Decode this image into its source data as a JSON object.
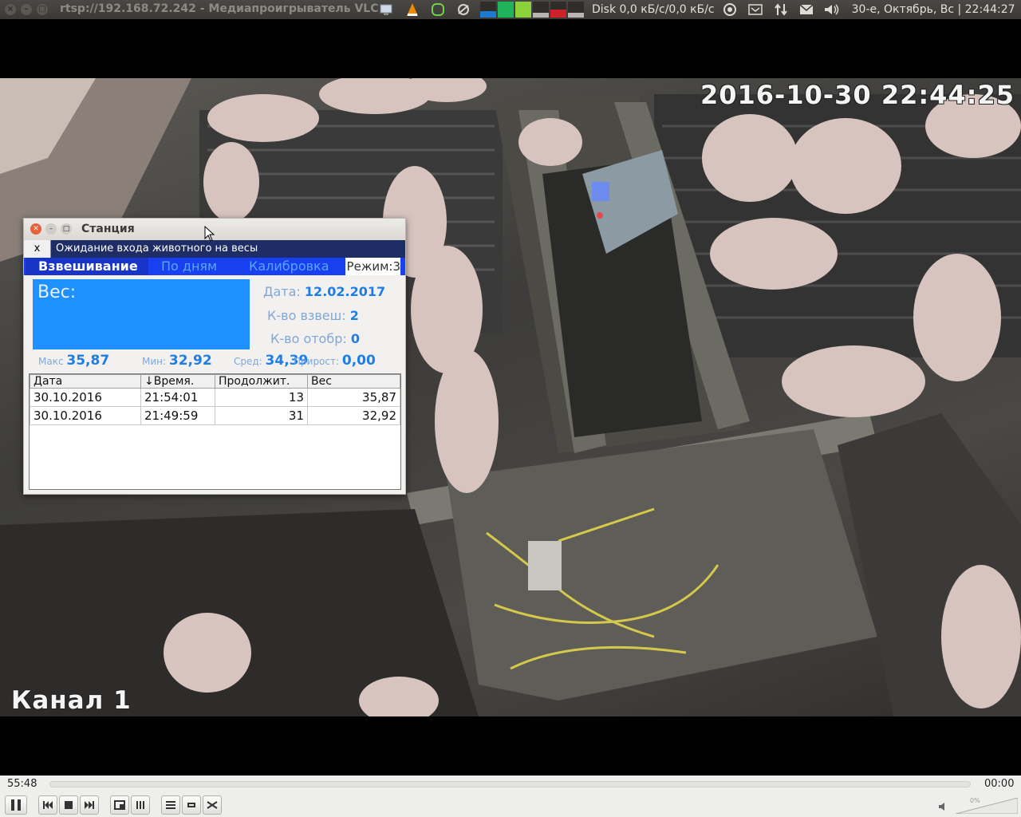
{
  "panel": {
    "window_title": "rtsp://192.168.72.242 - Медиапроигрыватель VLC",
    "window_buttons": [
      "×",
      "–",
      "□"
    ],
    "disk": "Disk 0,0 кБ/с/0,0 кБ/с",
    "clock": "30-е, Октябрь, Вс | 22:44:27",
    "tray_icons": [
      "network-icon",
      "vlc-icon",
      "evernote-icon",
      "weather-icon",
      "cpu-meter",
      "mem-meter",
      "net-meter",
      "load-meter",
      "swap-meter",
      "disk-meter",
      "power-icon",
      "mail-indicator-icon",
      "transfer-icon",
      "envelope-icon",
      "volume-icon"
    ],
    "meter_colors": [
      "#1f7acf",
      "#1fb35a",
      "#8bd13a",
      "#b8b6b2",
      "#d0202a",
      "#b8b6b2"
    ]
  },
  "video": {
    "timestamp": "2016-10-30 22:44:25",
    "channel": "Канал 1"
  },
  "station": {
    "title": "Станция",
    "close_btn": "x",
    "status": "Ожидание входа животного на весы",
    "tabs": [
      "Взвешивание",
      "По дням",
      "Калибровка"
    ],
    "mode": "Режим:3",
    "weight_label": "Вес:",
    "date_label": "Дата:",
    "date_value": "12.02.2017",
    "weighed_label": "К-во взвеш:",
    "weighed_value": "2",
    "rejected_label": "К-во отобр:",
    "rejected_value": "0",
    "max_label": "Макс",
    "max_value": "35,87",
    "min_label": "Мин:",
    "min_value": "32,92",
    "avg_label": "Сред:",
    "avg_value": "34,39",
    "gain_label": "Прирост:",
    "gain_value": "0,00",
    "columns": [
      "Дата",
      "↓Время.",
      "Продолжит.",
      "Вес"
    ],
    "rows": [
      [
        "30.10.2016",
        "21:54:01",
        "13",
        "35,87"
      ],
      [
        "30.10.2016",
        "21:49:59",
        "31",
        "32,92"
      ]
    ]
  },
  "player": {
    "elapsed": "55:48",
    "remaining": "00:00",
    "volume": "0%"
  }
}
